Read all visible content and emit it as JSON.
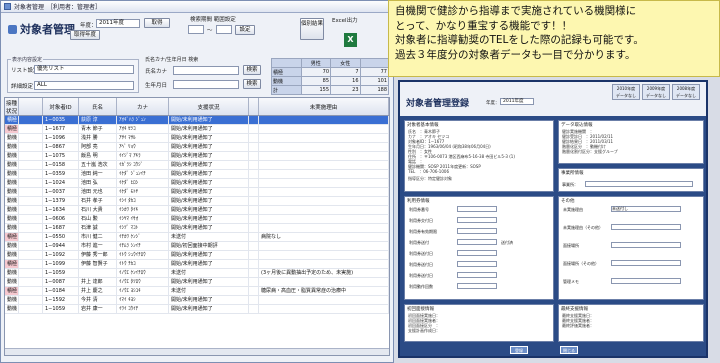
{
  "window": {
    "title": "対象者管理",
    "role": "［利用者：管理者］"
  },
  "header": {
    "title": "対象者管理",
    "year_label": "年度：",
    "year_value": "2011年度",
    "take_button": "取得",
    "fetch_year": "取得年度",
    "range_label": "検索期間 範囲設定",
    "range_sep": "〜",
    "set_button": "設定",
    "print_button": "個別結果",
    "excel_label": "Excel出力",
    "excel_glyph": "X"
  },
  "filters": {
    "display_label": "表示内容設定",
    "list_label": "リスト設定：",
    "list_value": "優先リスト",
    "detail_label": "詳細設定：",
    "detail_value": "ALL",
    "name_search": "氏名カナ/生年月日 検索",
    "kana_label": "氏名カナ",
    "birth_label": "生年月日",
    "search1": "検索",
    "search2": "検索"
  },
  "stats": {
    "headers": [
      "",
      "男性",
      "女性",
      ""
    ],
    "rows": [
      [
        "積極",
        "70",
        "7",
        "77"
      ],
      [
        "動機",
        "85",
        "16",
        "101"
      ],
      [
        "計",
        "155",
        "23",
        "188"
      ]
    ],
    "show_button": "対象者情報を表示"
  },
  "grid": {
    "headers": [
      "接種状況",
      "対象者ID",
      "氏名",
      "カナ",
      "支援状況",
      "",
      "未実施理由"
    ],
    "rows": [
      [
        "積極",
        "1−0035",
        "荻原 淳",
        "ｱｵｷﾞﾊﾗ ｼﾞｭﾝ",
        "開始/未利用通知了",
        "",
        ""
      ],
      [
        "積極",
        "1−1677",
        "青木 節子",
        "ｱｵｷ ｾﾂｺ",
        "開始/未利用通知了",
        "",
        ""
      ],
      [
        "動機",
        "1−1096",
        "浅井 勝",
        "ｱｻｲ ﾏｻﾙ",
        "開始/未利用通知了",
        "",
        ""
      ],
      [
        "動機",
        "1−0867",
        "阿部 亮",
        "ｱﾍﾞ ﾘｮｳ",
        "開始/未利用通知了",
        "",
        ""
      ],
      [
        "動機",
        "1−1075",
        "飯島 明",
        "ｲｲｼﾞﾏ ｱｷﾗ",
        "開始/未利用通知了",
        "",
        ""
      ],
      [
        "動機",
        "1−0158",
        "五十嵐 浩次",
        "ｲｶﾞﾗｼ ｺｳｼﾞ",
        "開始/未利用通知了",
        "",
        ""
      ],
      [
        "動機",
        "1−0359",
        "池田 純一",
        "ｲｹﾀﾞ ｼﾞｭﾝｲﾁ",
        "開始/未利用通知了",
        "",
        ""
      ],
      [
        "動機",
        "1−1024",
        "池田 弘",
        "ｲｹﾀﾞ ﾋﾛｼ",
        "開始/未利用通知了",
        "",
        ""
      ],
      [
        "動機",
        "1−0037",
        "池田 元也",
        "ｲｹﾀﾞ ﾓﾄﾔ",
        "開始/未利用通知了",
        "",
        ""
      ],
      [
        "動機",
        "1−1379",
        "石井 孝子",
        "ｲｼｲ ﾀｶｺ",
        "開始/未利用通知了",
        "",
        ""
      ],
      [
        "動機",
        "1−1634",
        "石川 大貴",
        "ｲｼｶﾜ ﾀｲｷ",
        "開始/未利用通知了",
        "",
        ""
      ],
      [
        "動機",
        "1−0606",
        "石山 勲",
        "ｲｼﾔﾏ ｲｻｵ",
        "開始/未利用通知了",
        "",
        ""
      ],
      [
        "動機",
        "1−1687",
        "石津 誠",
        "ｲｼﾂﾞ ﾏｺﾄ",
        "開始/未利用通知了",
        "",
        ""
      ],
      [
        "積極",
        "1−0550",
        "市川 健二",
        "ｲﾁｶﾜ ｹﾝｼﾞ",
        "未送付",
        "",
        "病院なし"
      ],
      [
        "動機",
        "1−0944",
        "市村 進一",
        "ｲﾁﾑﾗ ｼﾝｲﾁ",
        "開始/初回面接中期評",
        "",
        ""
      ],
      [
        "動機",
        "1−1092",
        "伊藤 秀一郎",
        "ｲﾄｳ ｼｭｳｲﾁﾛｳ",
        "開始/未利用通知了",
        "",
        ""
      ],
      [
        "積極",
        "1−1099",
        "伊藤 智賢子",
        "ｲﾄｳ ﾁｶｺ",
        "開始/未利用通知了",
        "",
        ""
      ],
      [
        "動機",
        "1−1059",
        "",
        "ｲﾉｳｴ ｹﾝｲﾁﾛｳ",
        "未送付",
        "",
        "(3ヶ月後に異動抽出予定のため、未実施)"
      ],
      [
        "動機",
        "1−0087",
        "井上 達郎",
        "ｲﾉｳｴ ﾀﾂﾛｳ",
        "開始/未利用通知了",
        "",
        ""
      ],
      [
        "積極",
        "1−0184",
        "井上 慶之",
        "ｲﾉｳｴ ﾖｼﾕｷ",
        "未送付",
        "",
        "糖尿病・高血圧・脂質異常症の治療中"
      ],
      [
        "動機",
        "1−1592",
        "今井 清",
        "ｲﾏｲ ｷﾖｼ",
        "開始/未利用通知了",
        "",
        ""
      ],
      [
        "動機",
        "1−1059",
        "岩井 康一",
        "ｲﾜｲ ｺｳｲﾁ",
        "開始/未利用通知了",
        "",
        ""
      ]
    ]
  },
  "popup": {
    "lines": [
      "自機関で健診から指導まで実施されている機関様に",
      "とって、かなり重宝する機能です！！",
      "対象者に指導勧奨のTELをした際の記録も可能です。",
      "過去３年度分の対象者データも一目で分かります。"
    ]
  },
  "detail": {
    "title": "対象者管理登録",
    "year_label": "年度：",
    "year_value": "2011年度",
    "tabs": [
      [
        "2010年度",
        "データなし"
      ],
      [
        "2009年度",
        "データなし"
      ],
      [
        "2008年度",
        "データなし"
      ]
    ],
    "basic_title": "対象者基本情報",
    "basic_lines": [
      "氏名　：青木節子",
      "カナ　：アオキ セツコ",
      "対象者ID：1−1677",
      "生年月日：1963/06/04 (昭和38年06月04日)",
      "性別　：女性",
      "住所　：〒106-0073 港区西麻布5-16-38 寺田ビル5-3 (1)",
      "電話　：",
      "健診機関：SOSP  2011年度更新：SOSP",
      "TEL　：06-706-1006"
    ],
    "data_title": "データ取込情報",
    "data_lines": [
      "健診実施機関　：",
      "健診受診日　：2011/02/11",
      "健診結果日　：2011/03/11",
      "階層化区分　：動機付け",
      "階層化割付区分：支援グループ"
    ],
    "reason_label": "指導区分：特定健診対象",
    "job_title": "事業所情報",
    "job_label": "事業所：",
    "use_title": "利用券情報",
    "use_labels": [
      "利用券番号",
      "利用券交付日",
      "利用券有効期限",
      "利用券送付",
      "利用券送付日",
      "利用券送付日",
      "利用券送付日",
      "利用動作回数"
    ],
    "sent_text": "送付済",
    "other_title": "その他",
    "other_labels": [
      "未実施理由",
      "未実施理由（その他）",
      "面接場所",
      "面接場所（その他）",
      "管理メモ"
    ],
    "other_value": "未送付し",
    "hist_title": "初回面接情報",
    "hist_lines": [
      "初回面接実施日：",
      "初回面接実施者：",
      "初回面接区分　：",
      "支援計画作成日："
    ],
    "final_title": "最終支援情報",
    "final_lines": [
      "最終支援実施日：",
      "最終支援実施者：",
      "最終評価実施者："
    ],
    "buttons": [
      "登録",
      "閉じる"
    ]
  }
}
